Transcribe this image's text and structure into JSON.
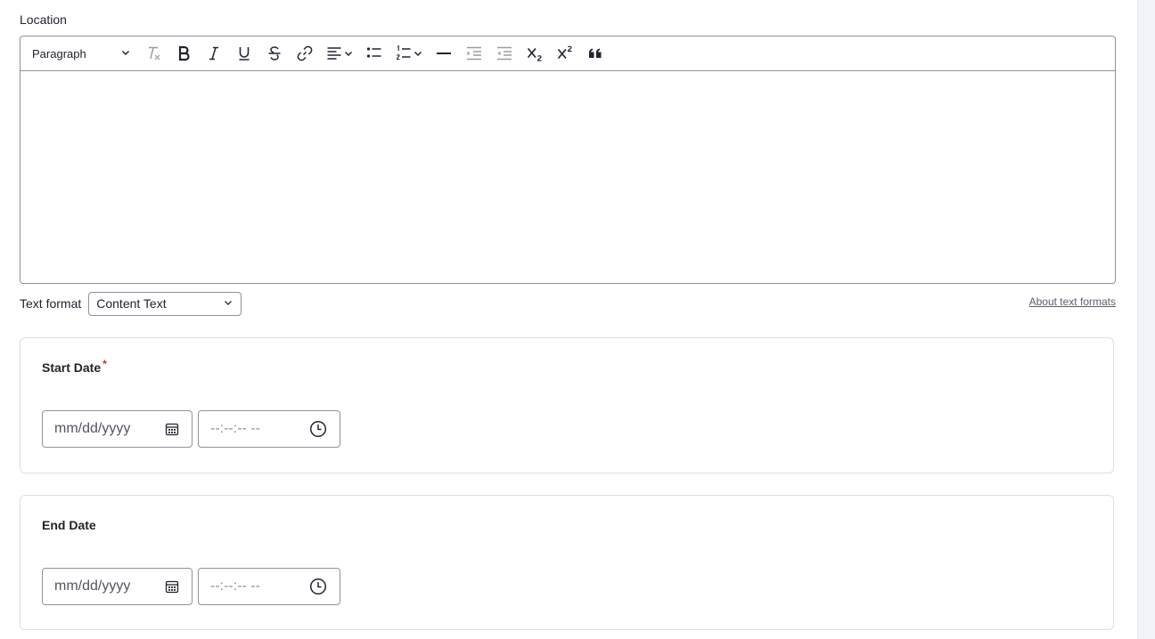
{
  "location": {
    "label": "Location",
    "toolbar": {
      "heading_value": "Paragraph",
      "buttons": [
        {
          "name": "remove-format",
          "icon": "remove-format-icon"
        },
        {
          "name": "bold",
          "icon": "bold-icon"
        },
        {
          "name": "italic",
          "icon": "italic-icon"
        },
        {
          "name": "underline",
          "icon": "underline-icon"
        },
        {
          "name": "strikethrough",
          "icon": "strikethrough-icon"
        },
        {
          "name": "link",
          "icon": "link-icon"
        },
        {
          "name": "align",
          "icon": "align-left-icon"
        },
        {
          "name": "bulleted-list",
          "icon": "bulleted-list-icon"
        },
        {
          "name": "numbered-list",
          "icon": "numbered-list-icon"
        },
        {
          "name": "horizontal-line",
          "icon": "horizontal-line-icon"
        },
        {
          "name": "indent",
          "icon": "indent-icon"
        },
        {
          "name": "outdent",
          "icon": "outdent-icon"
        },
        {
          "name": "subscript",
          "icon": "subscript-icon"
        },
        {
          "name": "superscript",
          "icon": "superscript-icon"
        },
        {
          "name": "blockquote",
          "icon": "blockquote-icon"
        }
      ]
    },
    "body_text": ""
  },
  "text_format": {
    "label": "Text format",
    "selected": "Content Text",
    "about_link": "About text formats"
  },
  "start_date": {
    "title": "Start Date",
    "required_mark": "*",
    "date_placeholder": "mm/dd/yyyy",
    "time_placeholder": "--:--:-- --"
  },
  "end_date": {
    "title": "End Date",
    "date_placeholder": "mm/dd/yyyy",
    "time_placeholder": "--:--:-- --"
  },
  "colors": {
    "border": "#8e929c",
    "panel_border": "#dedfe4",
    "required": "#dc2323",
    "text": "#222330"
  }
}
